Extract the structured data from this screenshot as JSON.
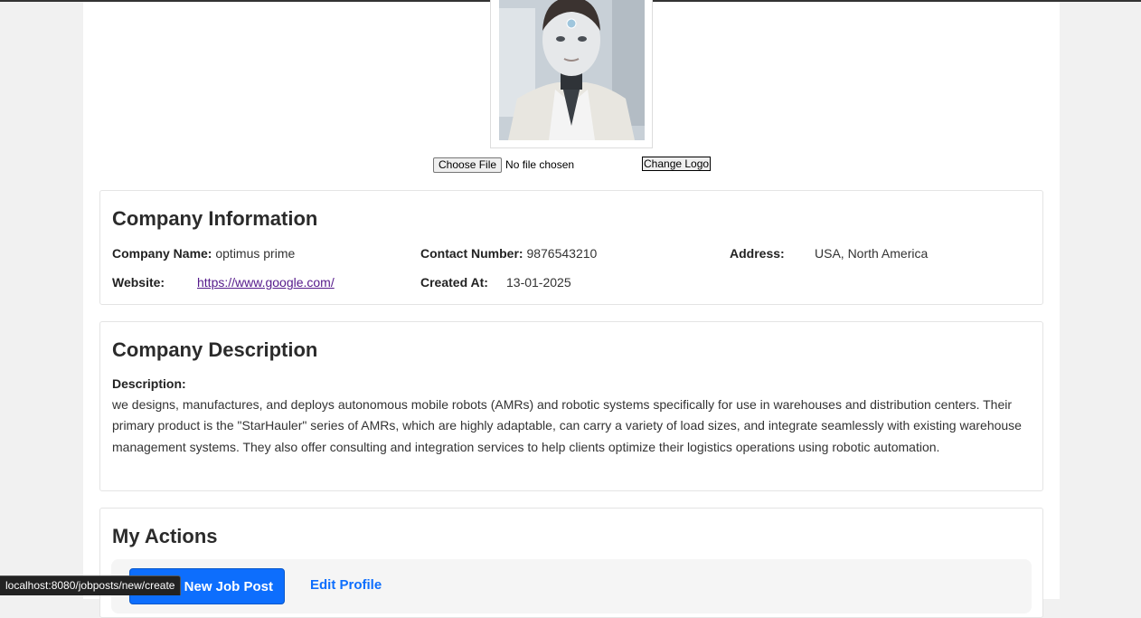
{
  "logo": {
    "file_button_label": "Choose File",
    "file_status": "No file chosen",
    "change_button_label": "Change Logo"
  },
  "company_info": {
    "heading": "Company Information",
    "name_label": "Company Name:",
    "name_value": "optimus prime",
    "contact_label": "Contact Number:",
    "contact_value": "9876543210",
    "address_label": "Address:",
    "address_value": "USA, North America",
    "website_label": "Website:",
    "website_value": "https://www.google.com/",
    "created_label": "Created At:",
    "created_value": "13-01-2025"
  },
  "company_description": {
    "heading": "Company Description",
    "label": "Description:",
    "text": "we designs, manufactures, and deploys autonomous mobile robots (AMRs) and robotic systems specifically for use in warehouses and distribution centers. Their primary product is the \"StarHauler\" series of AMRs, which are highly adaptable, can carry a variety of load sizes, and integrate seamlessly with existing warehouse management systems. They also offer consulting and integration services to help clients optimize their logistics operations using robotic automation."
  },
  "actions": {
    "heading": "My Actions",
    "new_job_label": "New Job Post",
    "edit_profile_label": "Edit Profile"
  },
  "status_bar": {
    "url": "localhost:8080/jobposts/new/create"
  },
  "colors": {
    "primary": "#0d6efd",
    "visited_link": "#551a8b"
  }
}
